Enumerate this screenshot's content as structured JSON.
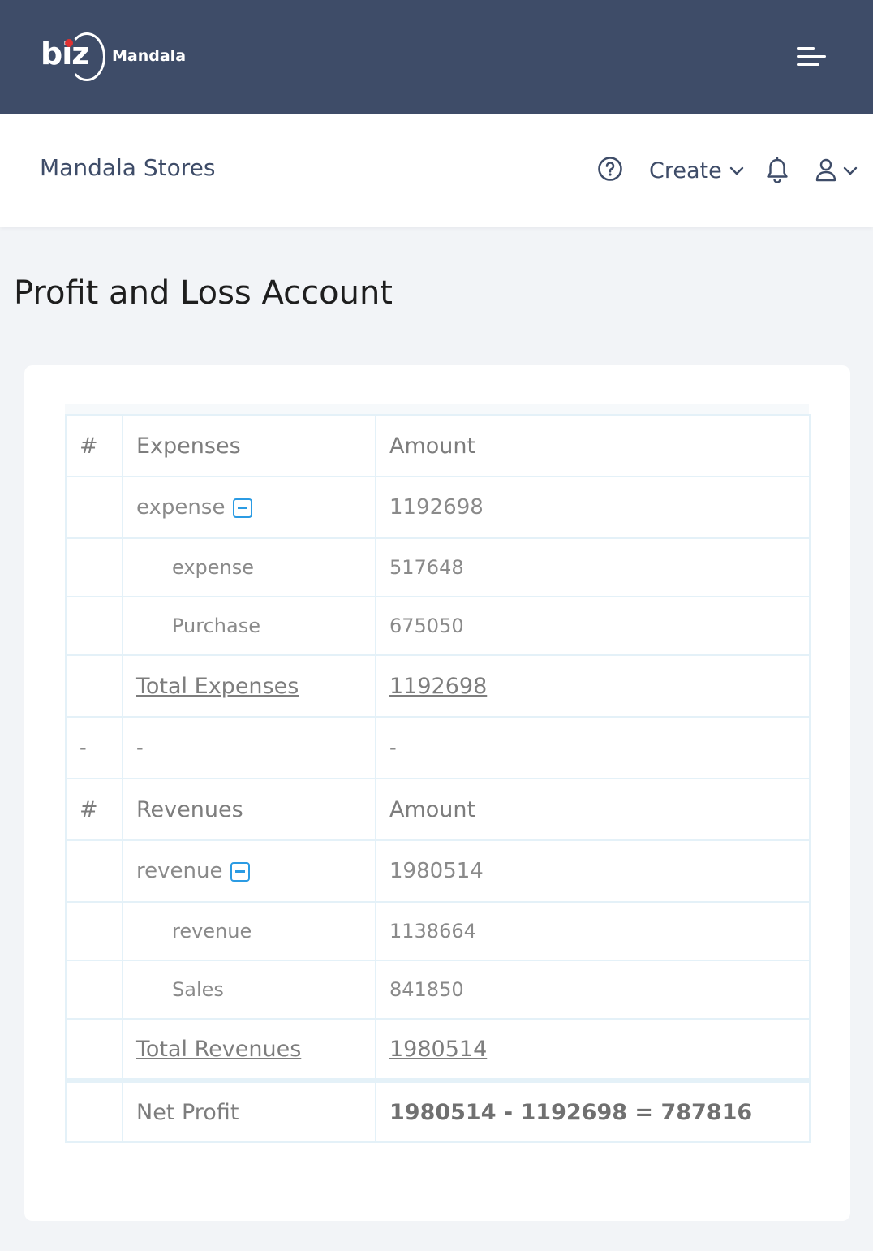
{
  "brand": {
    "logo_word": "biz",
    "logo_name": "Mandala"
  },
  "header": {
    "store_name": "Mandala Stores",
    "create_label": "Create",
    "icons": [
      "menu-icon",
      "help-icon",
      "chevron-down-icon",
      "bell-icon",
      "user-icon"
    ]
  },
  "page": {
    "title": "Profit and Loss Account"
  },
  "expenses": {
    "hash": "#",
    "header": "Expenses",
    "amount_header": "Amount",
    "group_label": "expense",
    "group_amount": "1192698",
    "items": [
      {
        "label": "expense",
        "amount": "517648"
      },
      {
        "label": "Purchase",
        "amount": "675050"
      }
    ],
    "total_label": "Total Expenses",
    "total_amount": "1192698"
  },
  "separator": {
    "c1": "-",
    "c2": "-",
    "c3": "-"
  },
  "revenues": {
    "hash": "#",
    "header": "Revenues",
    "amount_header": "Amount",
    "group_label": "revenue",
    "group_amount": "1980514",
    "items": [
      {
        "label": "revenue",
        "amount": "1138664"
      },
      {
        "label": "Sales",
        "amount": "841850"
      }
    ],
    "total_label": "Total Revenues",
    "total_amount": "1980514"
  },
  "net_profit": {
    "label": "Net Profit",
    "formula": "1980514 - 1192698 = 787816"
  },
  "colors": {
    "topbar": "#3e4c68",
    "accent": "#2b9be3",
    "logo_dot": "#e03131",
    "table_border": "#e4f1f8"
  }
}
